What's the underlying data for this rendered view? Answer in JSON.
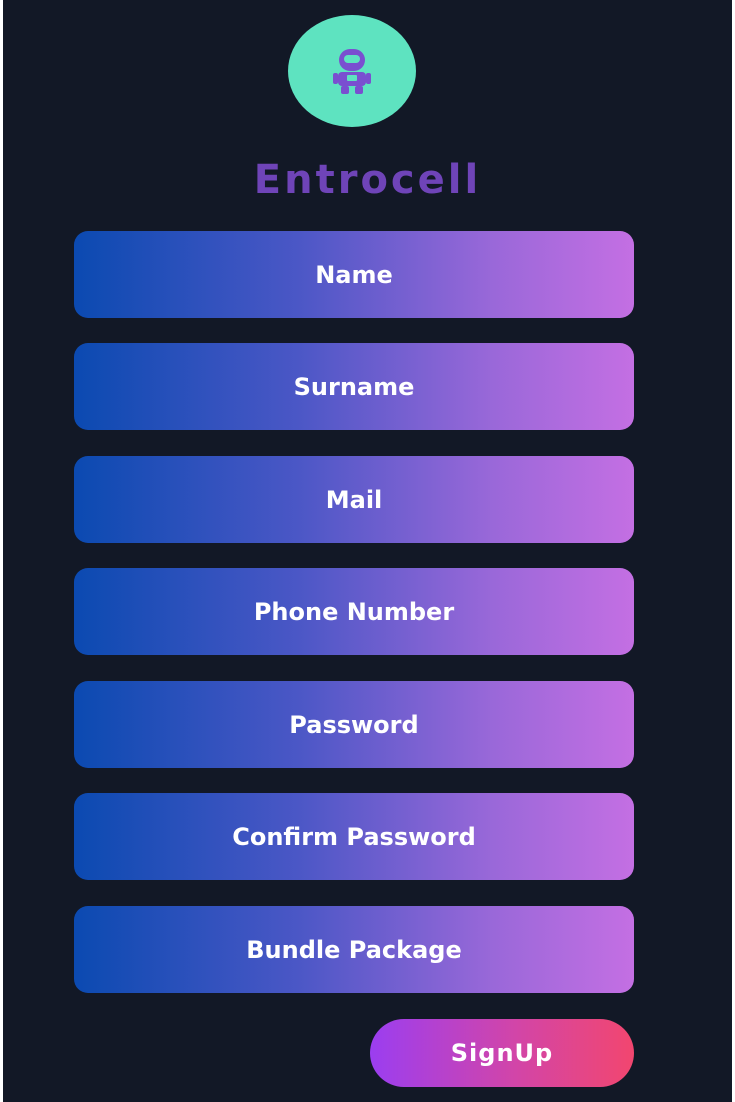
{
  "app": {
    "brand": "Entrocell",
    "logo_icon": "astronaut-icon",
    "colors": {
      "background": "#121826",
      "logo_circle": "#5ee3c0",
      "brand_text": "#6f44b8",
      "field_gradient_start": "#0b4ab1",
      "field_gradient_end": "#c46fe3",
      "button_gradient_start": "#9b3ef0",
      "button_gradient_end": "#f2466f"
    }
  },
  "form": {
    "fields": {
      "name": "Name",
      "surname": "Surname",
      "mail": "Mail",
      "phone": "Phone Number",
      "password": "Password",
      "confirm_password": "Confirm Password",
      "bundle_package": "Bundle Package"
    },
    "submit_label": "SignUp"
  }
}
